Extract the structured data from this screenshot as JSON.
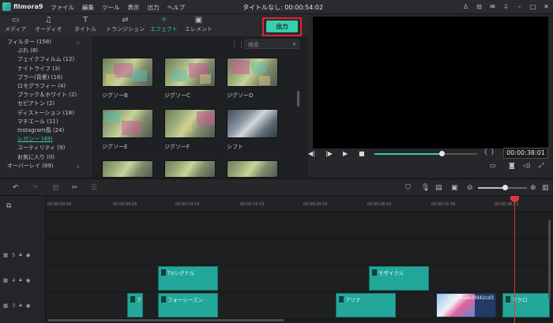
{
  "app": {
    "logo_text": "filmora9",
    "doc_title": "タイトルなし: 00:00:54:02"
  },
  "menu": [
    "ファイル",
    "編集",
    "ツール",
    "表示",
    "出力",
    "ヘルプ"
  ],
  "title_icons": [
    "account-icon",
    "cart-icon",
    "mail-icon",
    "download-icon",
    "minimize-icon",
    "maximize-icon",
    "close-icon"
  ],
  "toolbar": {
    "tabs": [
      {
        "label": "メディア",
        "icon": "folder-icon"
      },
      {
        "label": "オーディオ",
        "icon": "music-icon"
      },
      {
        "label": "タイトル",
        "icon": "text-icon"
      },
      {
        "label": "トランジション",
        "icon": "transition-icon"
      },
      {
        "label": "エフェクト",
        "icon": "effects-icon",
        "active": true
      },
      {
        "label": "エレメント",
        "icon": "image-icon"
      }
    ],
    "export_label": "出力"
  },
  "categories": [
    {
      "label": "フィルター (158)",
      "level": "top",
      "chevron": "⌄"
    },
    {
      "label": "ぶれ (8)",
      "level": "sub"
    },
    {
      "label": "フェイクフィルム (12)",
      "level": "sub"
    },
    {
      "label": "ナイトライフ (3)",
      "level": "sub"
    },
    {
      "label": "ブラー(背景) (16)",
      "level": "sub"
    },
    {
      "label": "ロモグラフィー (4)",
      "level": "sub"
    },
    {
      "label": "ブラック＆ホワイト (2)",
      "level": "sub"
    },
    {
      "label": "セピアトン (2)",
      "level": "sub"
    },
    {
      "label": "ディストーション (18)",
      "level": "sub"
    },
    {
      "label": "マチエール (11)",
      "level": "sub"
    },
    {
      "label": "Instagram風 (24)",
      "level": "sub"
    },
    {
      "label": "レガシー (49)",
      "level": "sub",
      "selected": true
    },
    {
      "label": "ユーティリティ (9)",
      "level": "sub"
    },
    {
      "label": "お気に入り (0)",
      "level": "sub"
    },
    {
      "label": "オーバーレイ (89)",
      "level": "top",
      "chevron": "⌄"
    }
  ],
  "search": {
    "placeholder": "検索"
  },
  "thumbnails": [
    {
      "label": "ジグソーB"
    },
    {
      "label": "ジグソーC"
    },
    {
      "label": "ジグソーD"
    },
    {
      "label": "ジグソーE"
    },
    {
      "label": "ジグソーF"
    },
    {
      "label": "シフト"
    }
  ],
  "preview": {
    "timecode": "00:00:38:01",
    "progress": 0.65,
    "braces": "{ }"
  },
  "timeline": {
    "ruler": [
      "00:00:00:00",
      "00:00:05:05",
      "00:00:10:10",
      "00:00:15:15",
      "00:00:20:20",
      "00:00:26:01",
      "00:00:31:06",
      "00:00:36:11"
    ],
    "tracks": [
      {
        "name": "5"
      },
      {
        "name": "4"
      },
      {
        "name": "3"
      }
    ],
    "clips_track4": [
      "TVシグナル",
      "モザイクル"
    ],
    "clips_track3": [
      "ア",
      "フォーシーズン",
      "アリナ",
      "3ce28aab0fd42cd3",
      "マクロ"
    ],
    "zoom_level": 0.55
  }
}
